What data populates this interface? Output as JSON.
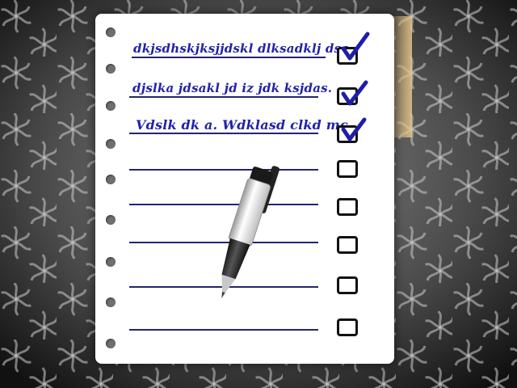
{
  "list": {
    "entries": [
      {
        "text": "dkjsdhskjksjjdskl dlksadklj dsa.",
        "checked": true
      },
      {
        "text": "djslka jdsakl jd  iz jdk ksjdas.",
        "checked": true
      },
      {
        "text": "Vdslk dk a. Wdklasd clkd mc.",
        "checked": true
      },
      {
        "text": "",
        "checked": false
      },
      {
        "text": "",
        "checked": false
      },
      {
        "text": "",
        "checked": false
      },
      {
        "text": "",
        "checked": false
      },
      {
        "text": "",
        "checked": false
      }
    ]
  },
  "colors": {
    "ink": "#2222a8",
    "rule": "#24246e",
    "check": "#1e1ea8",
    "paper": "#ffffff"
  },
  "icons": [
    "checkbox-icon",
    "checkmark-icon",
    "pen-icon",
    "binder-hole-icon"
  ]
}
